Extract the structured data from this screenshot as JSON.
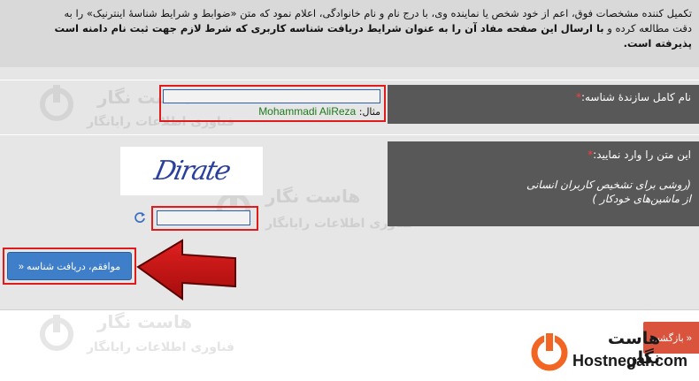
{
  "notice": {
    "line1": "تکمیل کننده مشخصات فوق، اعم از خود شخص یا نماینده وی، با درج نام و نام خانوادگی، اعلام نمود که متن «ضوابط و شرایط شناسهٔ اینترنیک» را به",
    "line2_normal": "دقت مطالعه کرده و",
    "line2_bold": "با ارسال این صفحه مفاد آن را به عنوان شرایط دریافت شناسه کاربری که شرط لازم جهت ثبت نام دامنه است",
    "line3_bold": "پذیرفته است."
  },
  "creator": {
    "label": "نام کامل سازندهٔ شناسه:",
    "required_mark": "*",
    "input_value": "",
    "example_prefix": "مثال:",
    "example_value": "Mohammadi AliReza"
  },
  "captcha": {
    "label": "این متن را وارد نمایید:",
    "required_mark": "*",
    "image_text": "Dirate",
    "help_line1": "(روشی برای تشخیص کاربران انسانی",
    "help_line2": "از ماشین‌های خودکار )",
    "input_value": ""
  },
  "buttons": {
    "submit": "موافقم، دریافت شناسه «",
    "back": "« بازگشت"
  },
  "watermark": {
    "title": "هاست نگار",
    "subtitle": "فناوری اطلاعات رایانگار"
  },
  "brand": {
    "name_fa": "هاست نگار",
    "name_en": "Hostnegar.com",
    "color": "#f26522"
  },
  "colors": {
    "label_bg": "#585858",
    "required": "#ff3b3b",
    "highlight": "#e01b1b",
    "button": "#3f7ec9",
    "example_text": "#1e7a1e"
  }
}
